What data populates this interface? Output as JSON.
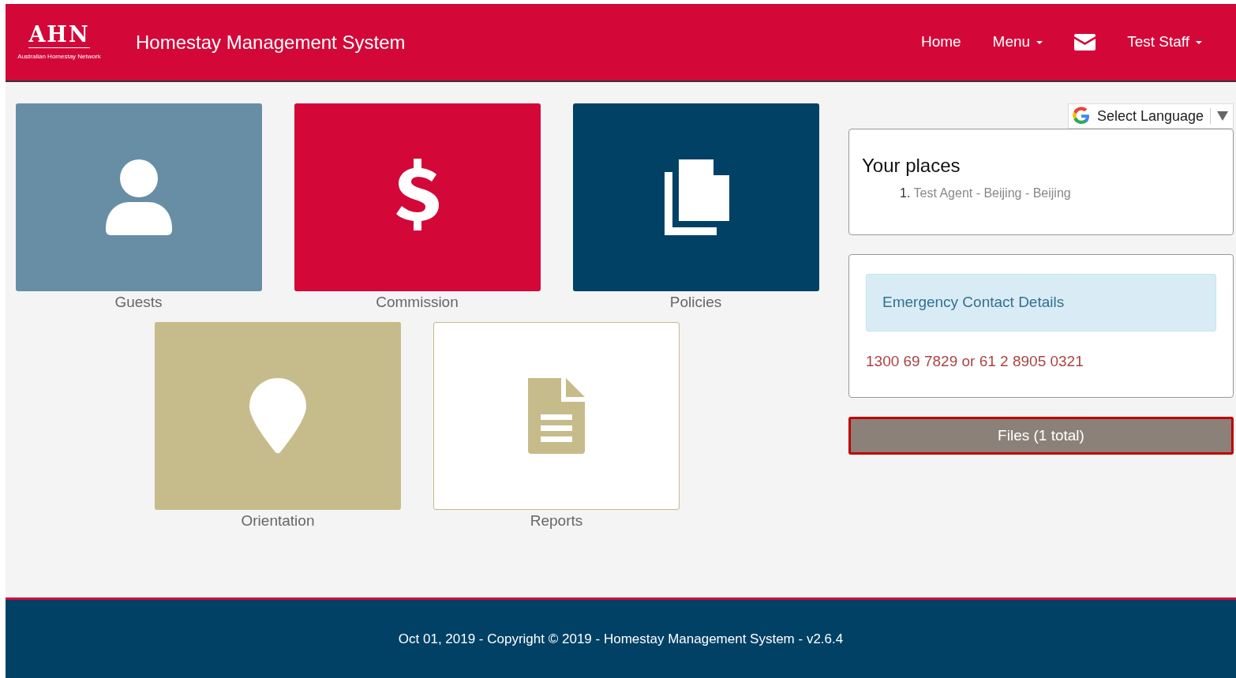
{
  "logo": {
    "letters": "AHN",
    "caption": "Australian Homestay Network"
  },
  "app_title": "Homestay Management System",
  "nav": [
    {
      "kind": "link",
      "label": "Home"
    },
    {
      "kind": "dropdown",
      "label": "Menu"
    },
    {
      "kind": "mail"
    },
    {
      "kind": "dropdown",
      "label": "Test Staff"
    }
  ],
  "tile_rows": [
    [
      {
        "kind": "person",
        "label": "Guests",
        "color": "#688ea6"
      },
      {
        "kind": "dollar",
        "label": "Commission",
        "color": "#d30839"
      },
      {
        "kind": "files",
        "label": "Policies",
        "color": "#004165"
      }
    ],
    [
      {
        "kind": "pin",
        "label": "Orientation",
        "color": "#c6bb8a"
      },
      {
        "kind": "document",
        "label": "Reports",
        "color": "#ffffff"
      }
    ]
  ],
  "language_select": {
    "label": "Select Language"
  },
  "places": {
    "title": "Your places",
    "items": [
      {
        "number": "1.",
        "text": "Test Agent - Beijing - Beijing"
      }
    ]
  },
  "emergency": {
    "title": "Emergency Contact Details",
    "phone": "1300 69 7829 or 61 2 8905 0321"
  },
  "files_button": {
    "label": "Files (1 total)",
    "focused": true
  },
  "footer": "Oct 01, 2019 - Copyright © 2019 - Homestay Management System - v2.6.4"
}
